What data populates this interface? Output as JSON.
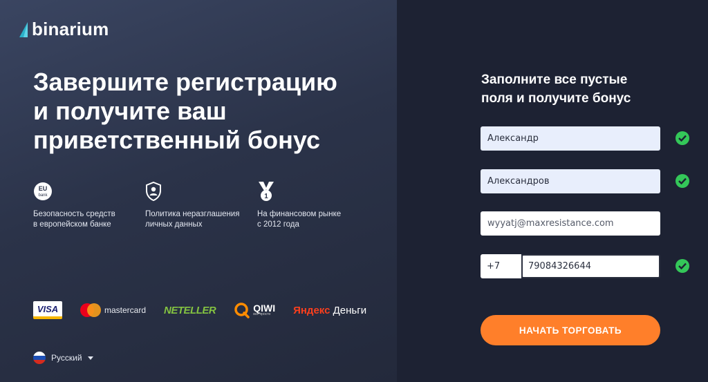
{
  "brand": {
    "name": "binarium"
  },
  "hero": {
    "line1": "Завершите регистрацию",
    "line2": "и получите ваш",
    "line3": "приветственный бонус"
  },
  "features": [
    {
      "icon": "eu-bank-icon",
      "line1": "Безопасность средств",
      "line2": "в европейском банке",
      "badge_top": "EU",
      "badge_bottom": "bank"
    },
    {
      "icon": "shield-user-icon",
      "line1": "Политика неразглашения",
      "line2": "личных данных"
    },
    {
      "icon": "medal-icon",
      "line1": "На финансовом рынке",
      "line2": "с 2012 года",
      "badge": "1"
    }
  ],
  "payments": {
    "visa": "VISA",
    "mastercard": "mastercard",
    "neteller": "NETELLER",
    "qiwi": "QIWI",
    "qiwi_sub": "все просто",
    "yandex_brand": "Яндекс",
    "yandex_word": "Деньги"
  },
  "language": {
    "selected": "Русский"
  },
  "form": {
    "title_line1": "Заполните все пустые",
    "title_line2": "поля и получите бонус",
    "first_name": "Александр",
    "last_name": "Александров",
    "email": "wyyatj@maxresistance.com",
    "phone_code": "+7",
    "phone_number": "79084326644",
    "submit_label": "НАЧАТЬ ТОРГОВАТЬ"
  },
  "colors": {
    "accent": "#ff7f2a",
    "success": "#34c759",
    "logo_teal": "#2bb0c8"
  }
}
